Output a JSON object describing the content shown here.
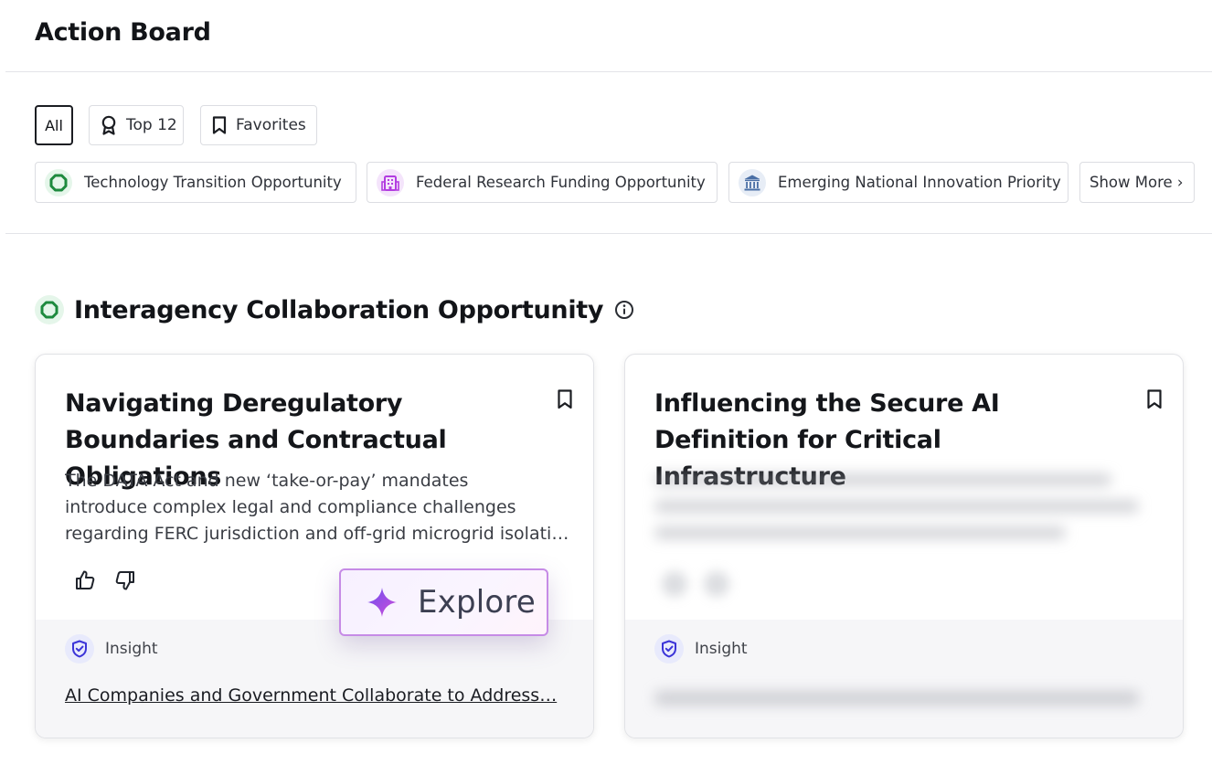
{
  "header": {
    "title": "Action Board"
  },
  "filters": {
    "all_label": "All",
    "top_label": "Top 12",
    "favorites_label": "Favorites"
  },
  "categories": [
    {
      "label": "Technology Transition Opportunity",
      "icon": "green-octagon-icon",
      "color": "#1e8a3e"
    },
    {
      "label": "Federal Research Funding Opportunity",
      "icon": "building-icon",
      "color": "#b23de0"
    },
    {
      "label": "Emerging National Innovation Priority",
      "icon": "capitol-icon",
      "color": "#4a6fa5"
    }
  ],
  "show_more_label": "Show More ›",
  "section": {
    "title": "Interagency Collaboration Opportunity",
    "icon": "green-octagon-icon",
    "info_icon": "info-icon"
  },
  "cards": [
    {
      "title": "Navigating Deregulatory Boundaries and Contractual Obligations",
      "description_lines": [
        "The DATA Act and new ‘take-or-pay’ mandates",
        "introduce complex legal and compliance challenges",
        "regarding FERC jurisdiction and off-grid microgrid isolati…"
      ],
      "insight_label": "Insight",
      "insight_link": "AI Companies and Government Collaborate to Address…"
    },
    {
      "title": "Influencing the Secure AI Definition for Critical Infrastructure",
      "insight_label": "Insight"
    }
  ],
  "explore": {
    "label": "Explore"
  },
  "colors": {
    "accent_green": "#1e8a3e",
    "insight_blue": "#3b34d8",
    "explore_border": "#c68be6",
    "spark_start": "#6b4df0",
    "spark_end": "#d14fd8"
  }
}
